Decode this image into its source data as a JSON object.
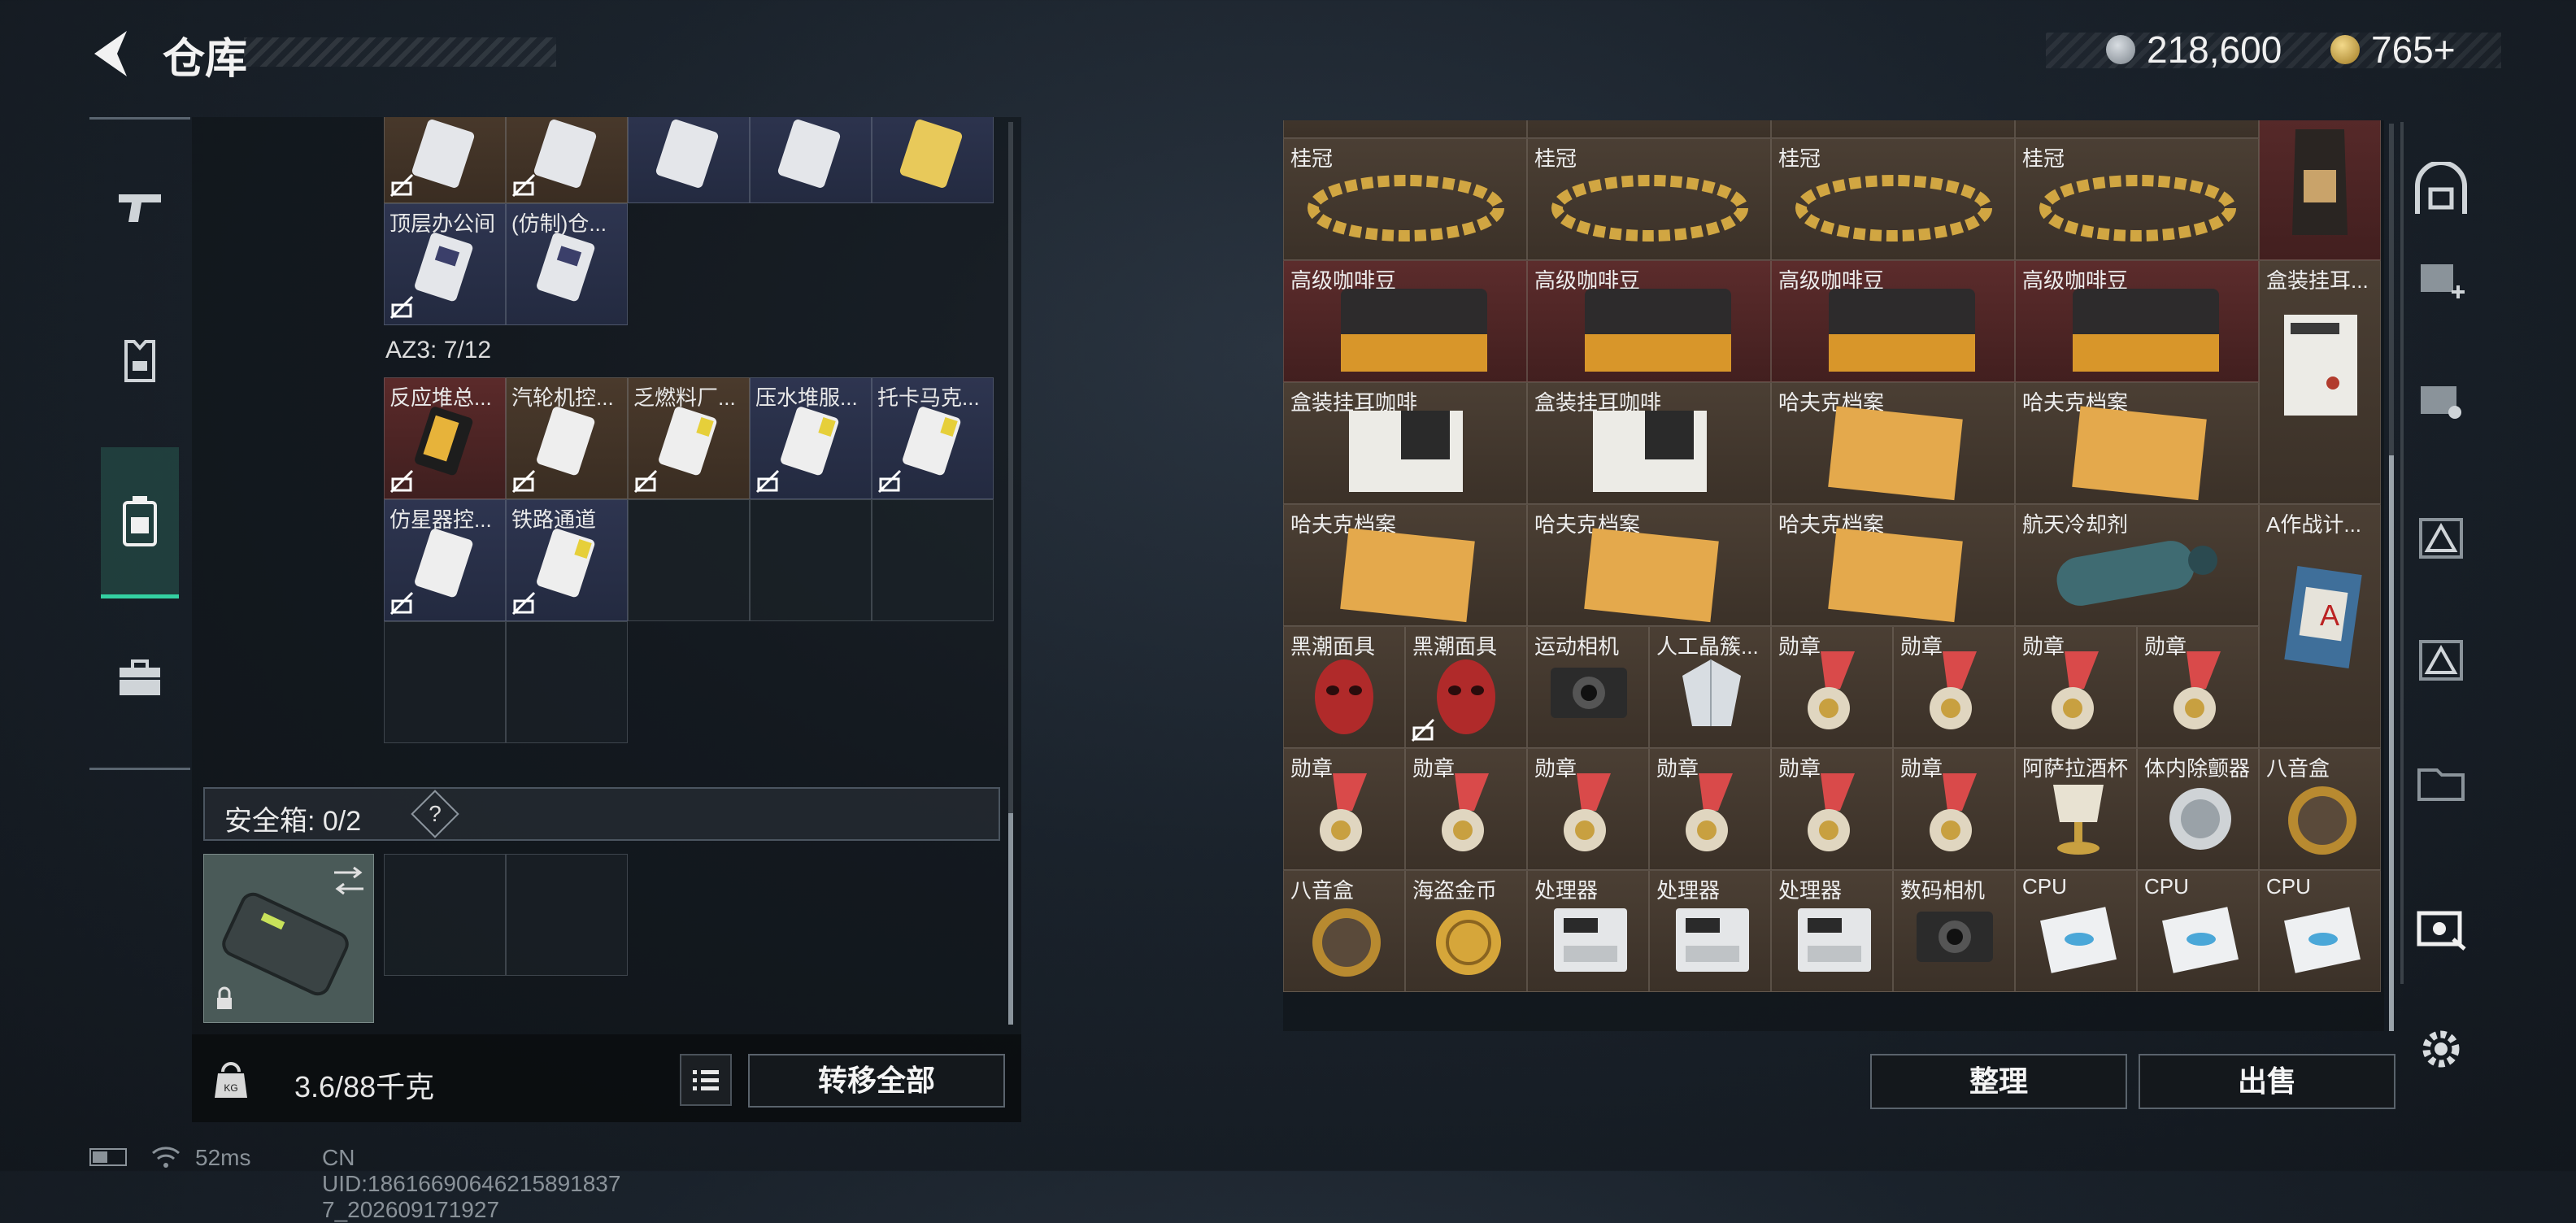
{
  "header": {
    "title": "仓库",
    "currency_silver": "218,600",
    "currency_gold": "765+"
  },
  "left_sidebar": {
    "tabs": [
      {
        "name": "weapon"
      },
      {
        "name": "equipment"
      },
      {
        "name": "backpack"
      },
      {
        "name": "case"
      }
    ],
    "active_index": 2
  },
  "left_inventory": {
    "top_row": [
      "",
      "",
      "",
      "",
      ""
    ],
    "row2": [
      "顶层办公间",
      "(仿制)仓..."
    ],
    "az3_label": "AZ3: 7/12",
    "az3_row1": [
      "反应堆总...",
      "汽轮机控...",
      "乏燃料厂...",
      "压水堆服...",
      "托卡马克..."
    ],
    "az3_row2": [
      "仿星器控...",
      "铁路通道"
    ]
  },
  "safebox": {
    "label": "安全箱:  0/2",
    "help": "?"
  },
  "footer_left": {
    "weight": "3.6/88千克",
    "transfer_all": "转移全部"
  },
  "right_inventory": {
    "top_partial": [
      "",
      "",
      "",
      "",
      ""
    ],
    "row_laurel": [
      "桂冠",
      "桂冠",
      "桂冠",
      "桂冠"
    ],
    "row_coffee": [
      "高级咖啡豆",
      "高级咖啡豆",
      "高级咖啡豆",
      "高级咖啡豆",
      "盒装挂耳..."
    ],
    "row_mixed1": [
      "盒装挂耳咖啡",
      "盒装挂耳咖啡",
      "哈夫克档案",
      "哈夫克档案"
    ],
    "row_mixed2": [
      "哈夫克档案",
      "哈夫克档案",
      "哈夫克档案",
      "航天冷却剂",
      "A作战计..."
    ],
    "row_small1": [
      "黑潮面具",
      "黑潮面具",
      "运动相机",
      "人工晶簇...",
      "勋章",
      "勋章",
      "勋章",
      "勋章"
    ],
    "row_small2": [
      "勋章",
      "勋章",
      "勋章",
      "勋章",
      "勋章",
      "勋章",
      "阿萨拉酒杯",
      "体内除颤器",
      "八音盒"
    ],
    "row_small3": [
      "八音盒",
      "海盗金币",
      "处理器",
      "处理器",
      "处理器",
      "数码相机",
      "CPU",
      "CPU",
      "CPU"
    ]
  },
  "footer_right": {
    "sort": "整理",
    "sell": "出售"
  },
  "status": {
    "ping": "52ms",
    "uid": "CN UID:18616690646215891837 7_202609171927"
  },
  "colors": {
    "accent": "#34d1a2",
    "cell_blue": "#2e3550",
    "cell_brown": "#4b3f34",
    "cell_red": "#5c2c2c"
  }
}
